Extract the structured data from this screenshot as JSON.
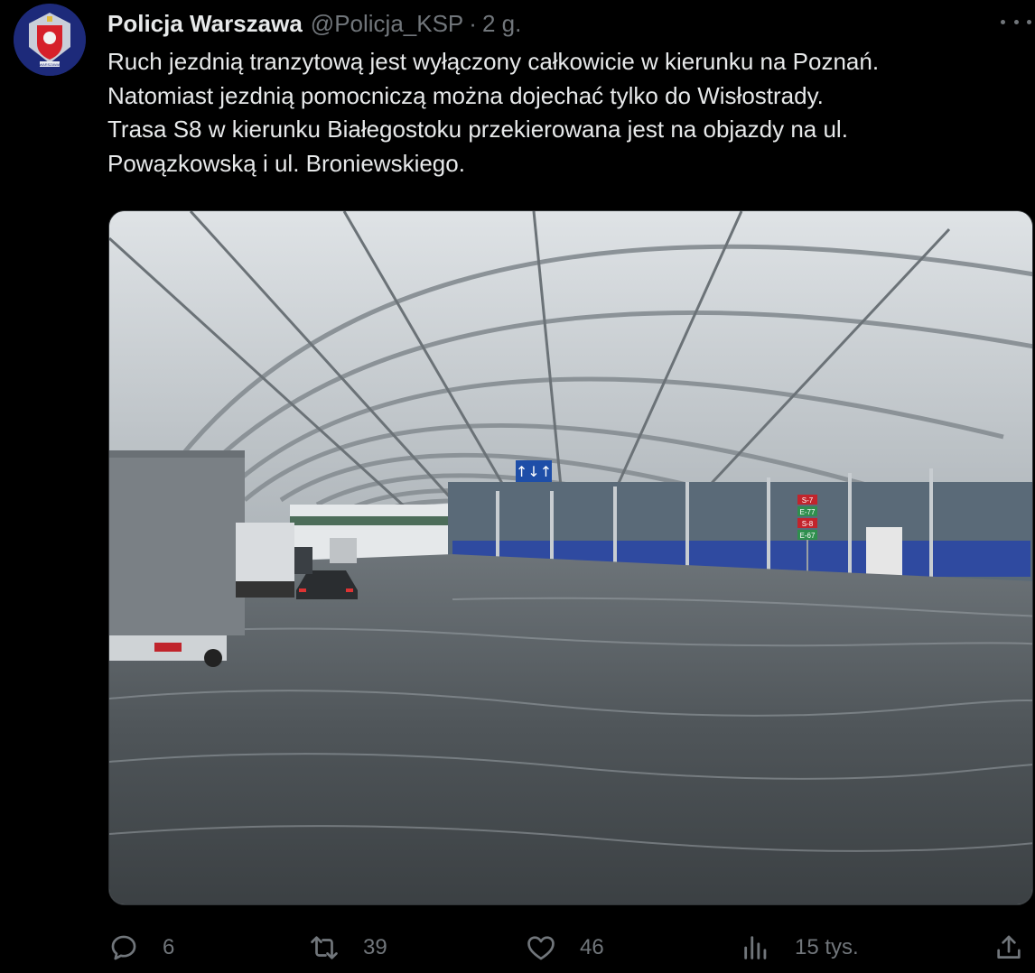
{
  "tweet": {
    "author_name": "Policja Warszawa",
    "handle": "@Policja_KSP",
    "separator": "·",
    "time": "2 g.",
    "text_lines": [
      "Ruch jezdnią tranzytową jest wyłączony całkowicie w kierunku na Poznań.",
      "Natomiast jezdnią pomocniczą można dojechać tylko do Wisłostrady.",
      "Trasa S8 w kierunku Białegostoku przekierowana jest na objazdy na ul.",
      "Powązkowską i ul. Broniewskiego."
    ],
    "avatar_caption": "WARSZAWA"
  },
  "photo": {
    "road_signs": [
      "S-7",
      "E-77",
      "S-8",
      "E-67"
    ],
    "overhead_sign": "↑↓↑"
  },
  "actions": {
    "reply_count": "6",
    "retweet_count": "39",
    "like_count": "46",
    "views_count": "15 tys."
  },
  "icons": {
    "reply": "reply-icon",
    "retweet": "retweet-icon",
    "like": "heart-icon",
    "views": "views-icon",
    "share": "share-icon",
    "more": "more-icon"
  },
  "colors": {
    "background": "#000000",
    "text": "#e7e9ea",
    "muted": "#71767b",
    "avatar_bg": "#1d2a7a"
  }
}
